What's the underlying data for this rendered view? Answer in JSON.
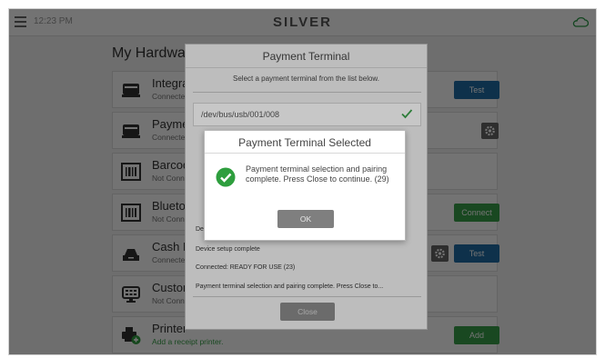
{
  "topbar": {
    "time": "12:23 PM",
    "brand": "SILVER"
  },
  "page": {
    "title": "My Hardware"
  },
  "hardware_rows": [
    {
      "name": "Integrated",
      "status": "Connected",
      "icon": "card-reader-icon",
      "status_color": "gray"
    },
    {
      "name": "Payment Terminal",
      "status": "Connected",
      "icon": "card-reader-icon",
      "status_color": "gray"
    },
    {
      "name": "Barcode Scanner",
      "status": "Not Connected",
      "icon": "barcode-icon",
      "status_color": "gray"
    },
    {
      "name": "Bluetooth",
      "status": "Not Connected",
      "icon": "barcode-icon",
      "status_color": "gray"
    },
    {
      "name": "Cash Drawer",
      "status": "Connected",
      "icon": "cash-drawer-icon",
      "status_color": "gray"
    },
    {
      "name": "Customer Display",
      "status": "Not Connected",
      "icon": "display-icon",
      "status_color": "gray"
    },
    {
      "name": "Printer",
      "status": "Add a receipt printer.",
      "icon": "printer-add-icon",
      "status_color": "green"
    }
  ],
  "row_buttons": {
    "test": "Test",
    "connect": "Connect",
    "add": "Add"
  },
  "terminal_dialog": {
    "title": "Payment Terminal",
    "subtitle": "Select a payment terminal from the list below.",
    "device_path": "/dev/bus/usb/001/008",
    "log": [
      "Dev",
      "Device setup complete",
      "Connected: READY FOR USE (23)",
      "Payment terminal selection and pairing complete.  Press Close to..."
    ],
    "close_label": "Close"
  },
  "selected_dialog": {
    "title": "Payment Terminal Selected",
    "message": "Payment terminal selection and pairing complete.  Press Close to continue. (29)",
    "ok_label": "OK"
  },
  "colors": {
    "accent_blue": "#1f6da6",
    "accent_green": "#3aa14a",
    "success_green": "#2e9e3e"
  }
}
